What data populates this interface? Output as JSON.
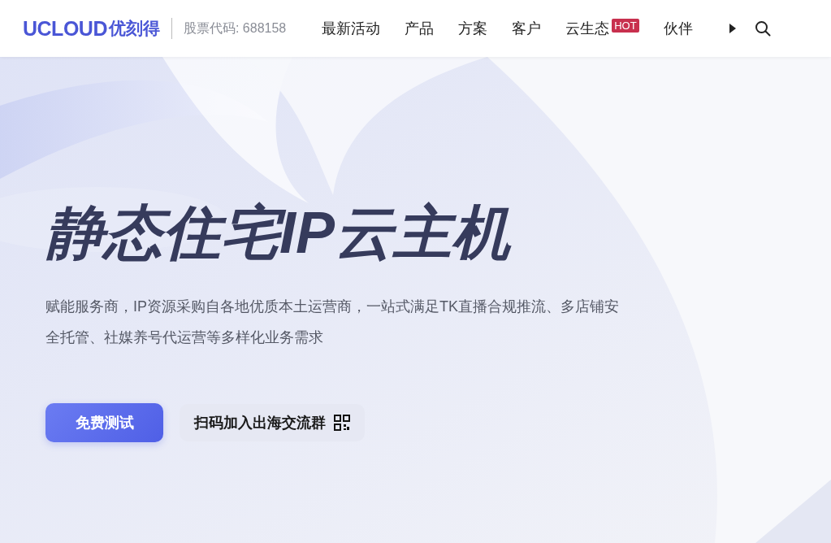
{
  "header": {
    "logo": {
      "brand": "UCLOUD",
      "name": "优刻得"
    },
    "stock": "股票代码: 688158",
    "nav": [
      {
        "label": "最新活动"
      },
      {
        "label": "产品"
      },
      {
        "label": "方案"
      },
      {
        "label": "客户"
      },
      {
        "label": "云生态",
        "badge": "HOT"
      },
      {
        "label": "伙伴"
      }
    ]
  },
  "hero": {
    "title": "静态住宅IP云主机",
    "description": "赋能服务商，IP资源采购自各地优质本土运营商，一站式满足TK直播合规推流、多店铺安全托管、社媒养号代运营等多样化业务需求",
    "buttons": [
      {
        "label": "免费测试",
        "kind": "primary"
      },
      {
        "label": "扫码加入出海交流群",
        "kind": "qr"
      }
    ]
  }
}
